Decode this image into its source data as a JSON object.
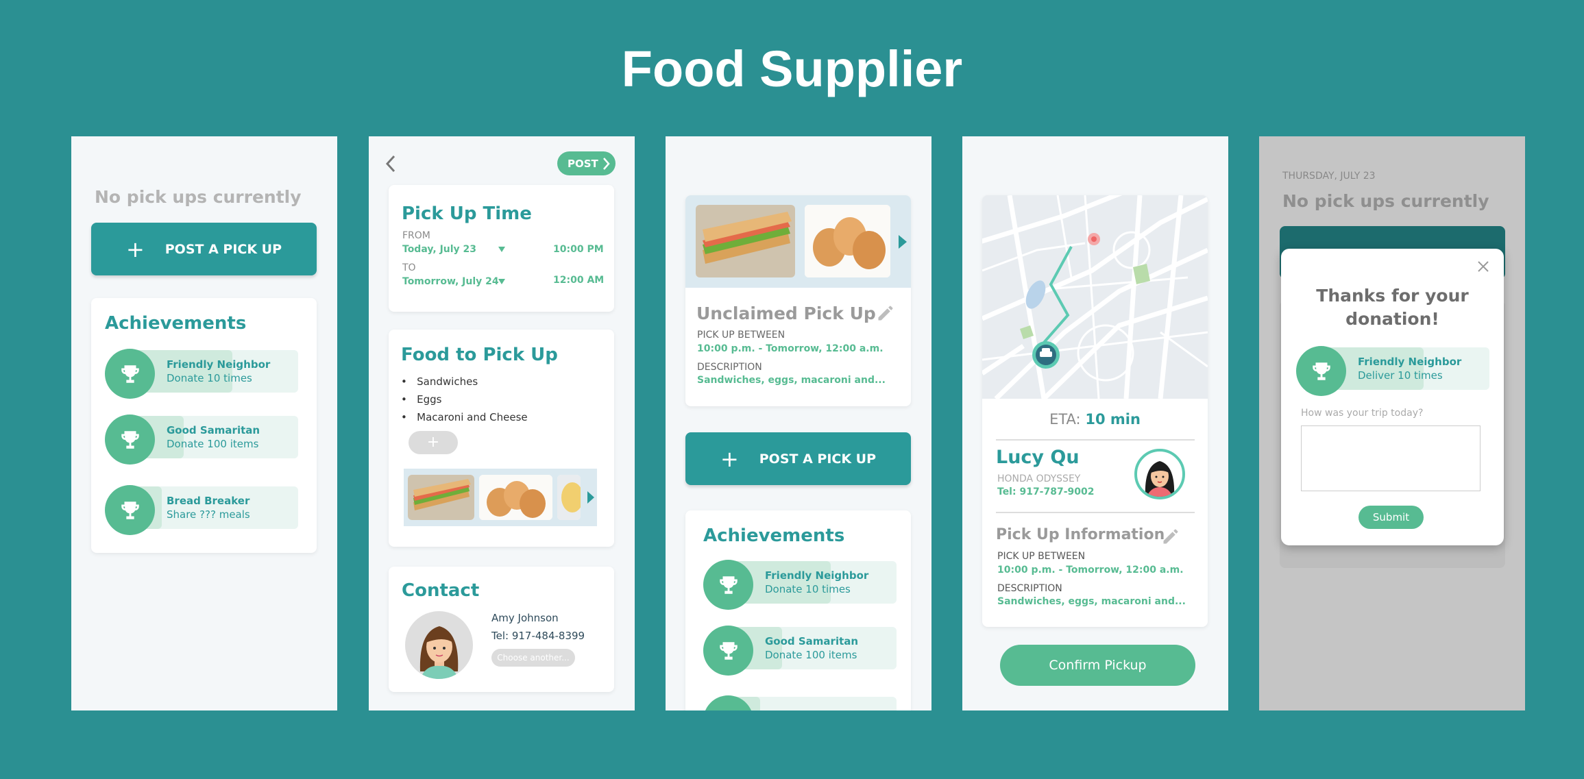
{
  "page_title": "Food Supplier",
  "colors": {
    "background": "#2b9092",
    "teal": "#2b9a9a",
    "green": "#57bb92"
  },
  "screen1": {
    "status": "No pick ups currently",
    "post_button": "POST A PICK UP",
    "achievements_title": "Achievements",
    "achievements": [
      {
        "name": "Friendly Neighbor",
        "desc": "Donate 10 times",
        "progress": 0.6
      },
      {
        "name": "Good Samaritan",
        "desc": "Donate 100 items",
        "progress": 0.3
      },
      {
        "name": "Bread Breaker",
        "desc": "Share ??? meals",
        "progress": 0.2
      }
    ]
  },
  "screen2": {
    "post_label": "POST",
    "pickup_time": {
      "title": "Pick Up Time",
      "from_label": "FROM",
      "from_date": "Today, July 23",
      "from_time": "10:00 PM",
      "to_label": "TO",
      "to_date": "Tomorrow, July 24",
      "to_time": "12:00 AM"
    },
    "food": {
      "title": "Food to Pick Up",
      "items": [
        "Sandwiches",
        "Eggs",
        "Macaroni and Cheese"
      ],
      "add_label": "+"
    },
    "contact": {
      "title": "Contact",
      "name": "Amy Johnson",
      "tel": "Tel: 917-484-8399",
      "choose": "Choose another..."
    }
  },
  "screen3": {
    "title": "Unclaimed Pick Up",
    "between_label": "PICK UP BETWEEN",
    "between_value": "10:00 p.m. - Tomorrow, 12:00 a.m.",
    "desc_label": "DESCRIPTION",
    "desc_value": "Sandwiches, eggs, macaroni and...",
    "post_button": "POST A PICK UP",
    "achievements_title": "Achievements",
    "achievements": [
      {
        "name": "Friendly Neighbor",
        "desc": "Donate 10 times",
        "progress": 0.6
      },
      {
        "name": "Good Samaritan",
        "desc": "Donate 100 items",
        "progress": 0.3
      }
    ]
  },
  "screen4": {
    "eta_label": "ETA:",
    "eta_value": "10 min",
    "driver_name": "Lucy Qu",
    "car": "HONDA ODYSSEY",
    "tel": "Tel: 917-787-9002",
    "info_title": "Pick Up Information",
    "between_label": "PICK UP BETWEEN",
    "between_value": "10:00 p.m. - Tomorrow, 12:00 a.m.",
    "desc_label": "DESCRIPTION",
    "desc_value": "Sandwiches, eggs, macaroni and...",
    "confirm": "Confirm Pickup"
  },
  "screen5": {
    "date": "THURSDAY, JULY 23",
    "status": "No pick ups currently",
    "modal_title": "Thanks for your donation!",
    "achievement": {
      "name": "Friendly Neighbor",
      "desc": "Deliver 10 times",
      "progress": 0.6
    },
    "question": "How was your trip today?",
    "submit": "Submit"
  }
}
